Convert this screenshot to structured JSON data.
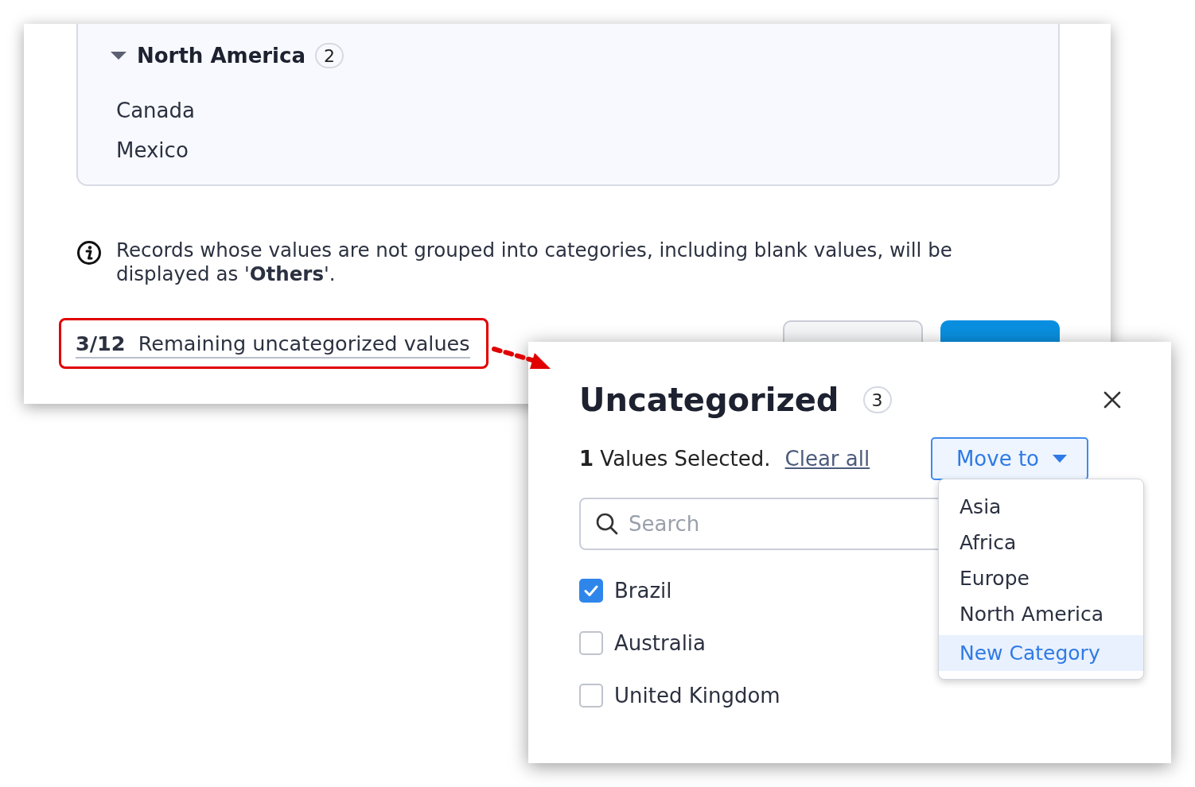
{
  "category": {
    "name": "North America",
    "count": "2",
    "expanded": true,
    "items": [
      "Canada",
      "Mexico"
    ]
  },
  "note": "Records whose values are not grouped into categories, including blank values, will be displayed as '**Others**'.",
  "remaining": {
    "count": "3/12",
    "label": "Remaining uncategorized values"
  },
  "buttons": [
    {
      "kind": "secondary"
    },
    {
      "kind": "primary"
    }
  ],
  "popup": {
    "title": "Uncategorized",
    "count": "3",
    "selected_count": "1",
    "selected_label": "Values Selected.",
    "clear": "Clear all",
    "move_button": "Move to",
    "search": {
      "placeholder": "Search"
    },
    "values": [
      {
        "label": "Brazil",
        "checked": true
      },
      {
        "label": "Australia",
        "checked": false
      },
      {
        "label": "United Kingdom",
        "checked": false
      }
    ],
    "menu": [
      {
        "label": "Asia",
        "selected": false
      },
      {
        "label": "Africa",
        "selected": false
      },
      {
        "label": "Europe",
        "selected": false
      },
      {
        "label": "North America",
        "selected": false
      },
      {
        "label": "New Category",
        "selected": true
      }
    ]
  }
}
